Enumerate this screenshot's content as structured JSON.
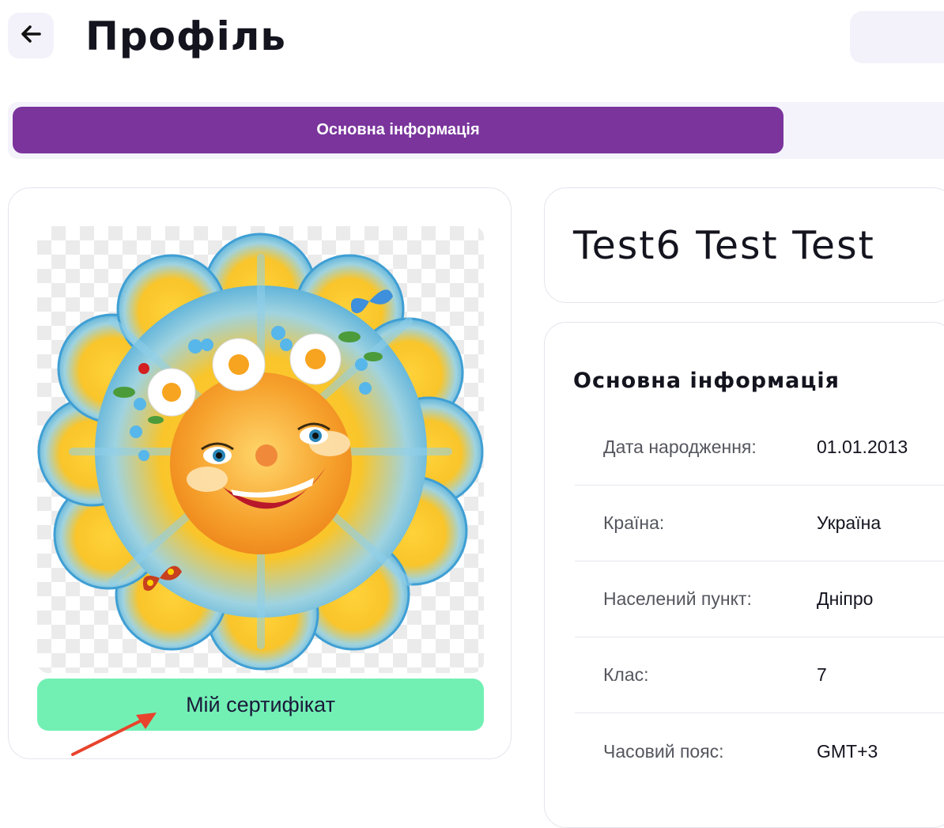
{
  "header": {
    "title": "Профіль",
    "back_icon": "arrow-left-icon"
  },
  "tabs": [
    {
      "label": "Основна інформація",
      "active": true
    }
  ],
  "profile": {
    "name": "Test6 Test Test",
    "avatar": "smiling-sun-avatar",
    "certificate_button": "Мій сертифікат"
  },
  "info": {
    "title": "Основна інформація",
    "rows": [
      {
        "label": "Дата народження:",
        "value": "01.01.2013"
      },
      {
        "label": "Країна:",
        "value": "Україна"
      },
      {
        "label": "Населений пункт:",
        "value": "Дніпро"
      },
      {
        "label": "Клас:",
        "value": "7"
      },
      {
        "label": "Часовий пояс:",
        "value": "GMT+3"
      }
    ]
  },
  "colors": {
    "accent": "#7a349c",
    "certificate_button": "#72f0b4",
    "annotation_arrow": "#e8432c"
  }
}
